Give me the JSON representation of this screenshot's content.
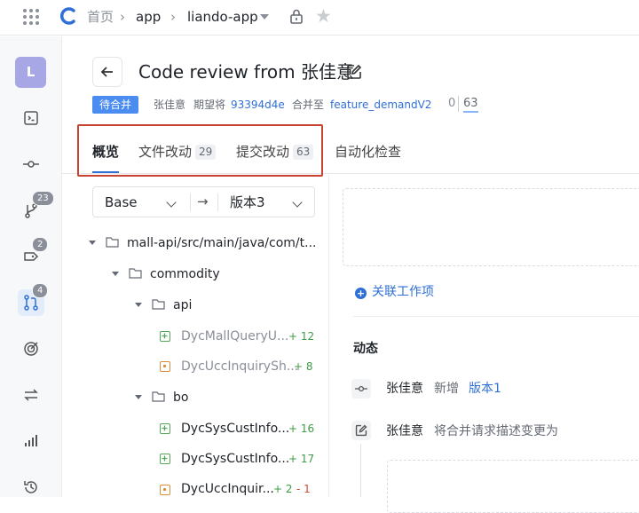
{
  "breadcrumb": {
    "home": "首页",
    "project": "app",
    "repo": "liando-app"
  },
  "user": {
    "avatar_initial": "L"
  },
  "sidebar": {
    "badges": {
      "branches": "23",
      "tags": "2",
      "merge_requests": "4"
    }
  },
  "mr": {
    "title": "Code review from 张佳意",
    "state": "待合并",
    "author": "张佳意",
    "expect_text": "期望将",
    "commit": "93394d4e",
    "merge_into_text": "合并至",
    "target_branch": "feature_demandV2",
    "behind": "0",
    "ahead": "63"
  },
  "tabs": [
    {
      "label": "概览"
    },
    {
      "label": "文件改动",
      "count": "29"
    },
    {
      "label": "提交改动",
      "count": "63"
    },
    {
      "label": "自动化检查"
    }
  ],
  "compare": {
    "base": "Base",
    "target": "版本3"
  },
  "tree": [
    {
      "label": "mall-api/src/main/java/com/t..."
    },
    {
      "label": "commodity"
    },
    {
      "label": "api"
    },
    {
      "label": "DycMallQueryU...",
      "add": "+ 12"
    },
    {
      "label": "DycUccInquirySh...",
      "add": "+ 8"
    },
    {
      "label": "bo"
    },
    {
      "label": "DycSysCustInfo...",
      "add": "+ 16"
    },
    {
      "label": "DycSysCustInfo...",
      "add": "+ 17"
    },
    {
      "label": "DycUccInquir...",
      "add": "+ 2",
      "del": "- 1"
    }
  ],
  "right": {
    "link_work_item": "关联工作项",
    "activity_title": "动态",
    "activities": [
      {
        "user": "张佳意",
        "action": "新增",
        "target": "版本1"
      },
      {
        "user": "张佳意",
        "action": "将合并请求描述变更为"
      }
    ]
  },
  "colors": {
    "accent": "#2f6fd6",
    "state_bg": "#4a8cf0",
    "highlight_border": "#c7432f",
    "added": "#3f9b47",
    "deleted": "#d64a3d"
  }
}
